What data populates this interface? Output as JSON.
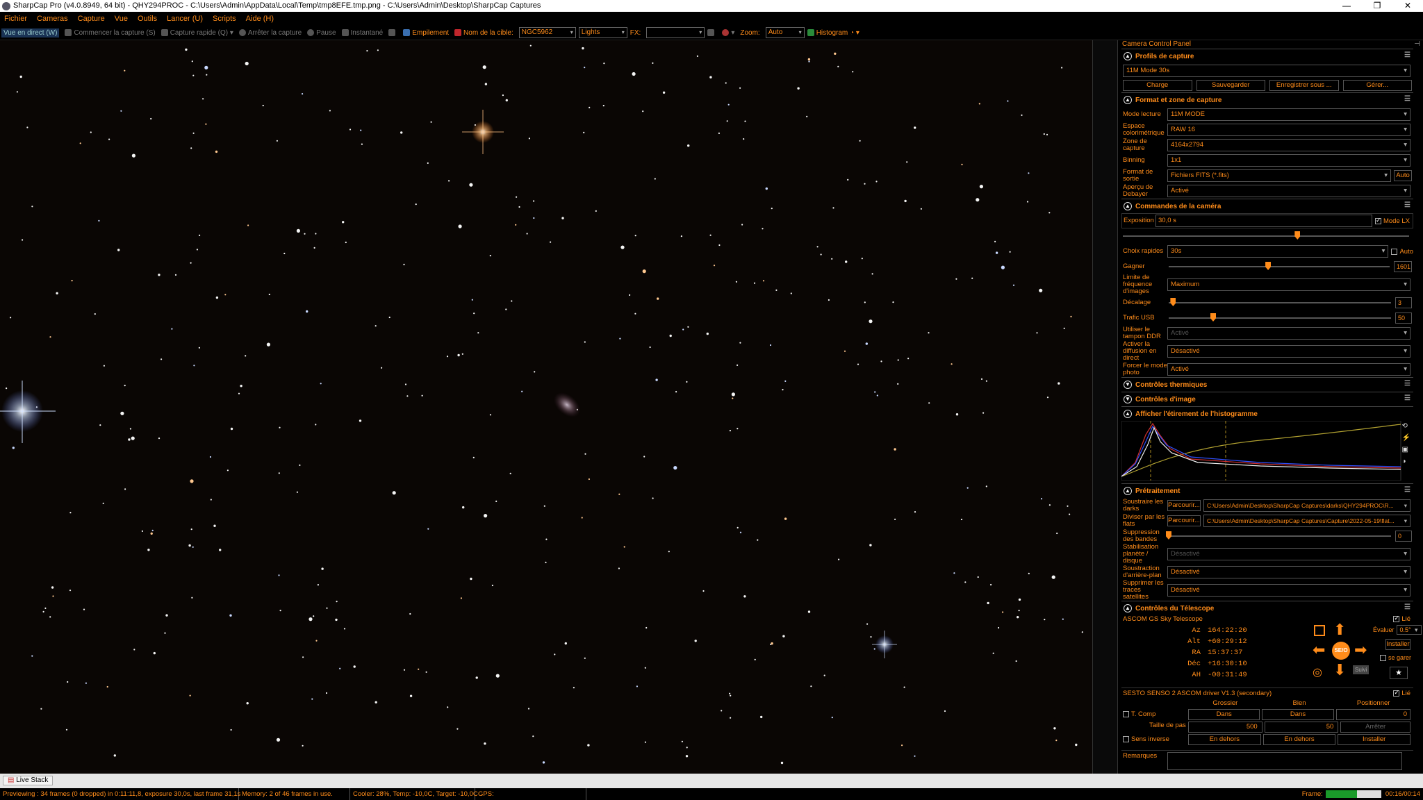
{
  "window": {
    "title": "SharpCap Pro (v4.0.8949, 64 bit) - QHY294PROC - C:\\Users\\Admin\\AppData\\Local\\Temp\\tmp8EFE.tmp.png - C:\\Users\\Admin\\Desktop\\SharpCap Captures"
  },
  "menu": [
    "Fichier",
    "Cameras",
    "Capture",
    "Vue",
    "Outils",
    "Lancer (U)",
    "Scripts",
    "Aide (H)"
  ],
  "toolbar": {
    "live_view": "Vue en direct (W)",
    "start_capture": "Commencer la capture (S)",
    "quick_capture": "Capture rapide (Q)",
    "stop_capture": "Arrêter la capture",
    "pause": "Pause",
    "snapshot": "Instantané",
    "stacking": "Empilement",
    "target_label": "Nom de la cible:",
    "target_value": "NGC5962",
    "frame_type": "Lights",
    "fx_label": "FX:",
    "zoom_label": "Zoom:",
    "zoom_value": "Auto",
    "histogram": "Histogram"
  },
  "panel": {
    "title": "Camera Control Panel",
    "profiles": {
      "header": "Profils de capture",
      "selected": "11M Mode 30s",
      "buttons": [
        "Charge",
        "Sauvegarder",
        "Enregistrer sous ...",
        "Gérer..."
      ]
    },
    "format": {
      "header": "Format et zone de capture",
      "rows": [
        {
          "label": "Mode lecture",
          "value": "11M MODE"
        },
        {
          "label": "Espace colorimétrique",
          "value": "RAW 16"
        },
        {
          "label": "Zone de capture",
          "value": "4164x2794"
        },
        {
          "label": "Binning",
          "value": "1x1"
        },
        {
          "label": "Format de sortie",
          "value": "Fichiers FITS (*.fits)",
          "extra": "Auto"
        },
        {
          "label": "Aperçu de Debayer",
          "value": "Activé"
        }
      ]
    },
    "camera": {
      "header": "Commandes de la caméra",
      "exposure_label": "Exposition",
      "exposure_value": "30,0 s",
      "lx_label": "Mode LX",
      "exposure_level": 0.61,
      "quick_label": "Choix rapides",
      "quick_value": "30s",
      "quick_auto": "Auto",
      "gain_label": "Gagner",
      "gain_value": "1601",
      "gain_level": 0.45,
      "framerate_label": "Limite de fréquence d'images",
      "framerate_value": "Maximum",
      "offset_label": "Décalage",
      "offset_value": "3",
      "offset_level": 0.02,
      "usb_label": "Trafic USB",
      "usb_value": "50",
      "usb_level": 0.2,
      "ddr_label": "Utiliser le tampon DDR",
      "ddr_value": "Activé",
      "broadcast_label": "Activer la diffusion en direct",
      "broadcast_value": "Désactivé",
      "photo_label": "Forcer le mode photo",
      "photo_value": "Activé"
    },
    "thermal_header": "Contrôles thermiques",
    "image_header": "Contrôles d'image",
    "histogram_header": "Afficher l'étirement de l'histogramme",
    "preprocess": {
      "header": "Prétraitement",
      "dark_label": "Soustraire les darks",
      "dark_browse": "Parcourir...",
      "dark_path": "C:\\Users\\Admin\\Desktop\\SharpCap Captures\\darks\\QHY294PROC\\R...",
      "flat_label": "Diviser par les flats",
      "flat_browse": "Parcourir...",
      "flat_path": "C:\\Users\\Admin\\Desktop\\SharpCap Captures\\Capture\\2022-05-19\\flat...",
      "banding_label": "Suppression des bandes",
      "banding_value": "0",
      "banding_level": 0,
      "stab_label": "Stabilisation planète / disque",
      "stab_value": "Désactivé",
      "bg_label": "Soustraction d'arrière-plan",
      "bg_value": "Désactivé",
      "sat_label": "Supprimer les traces satellites",
      "sat_value": "Désactivé"
    },
    "telescope": {
      "header": "Contrôles du Télescope",
      "mount": "ASCOM GS Sky Telescope",
      "linked": "Lié",
      "coords": [
        {
          "k": "Az",
          "v": "164:22:20"
        },
        {
          "k": "Alt",
          "v": "+60:29:12"
        },
        {
          "k": "RA",
          "v": "15:37:37"
        },
        {
          "k": "Déc",
          "v": "+16:30:10"
        },
        {
          "k": "AH",
          "v": "-00:31:49"
        }
      ],
      "rate_label": "Évaluer",
      "rate_value": "0.5°",
      "install": "Installer",
      "park": "se garer",
      "follow": "Suivi",
      "center": "SE/O"
    },
    "focuser": {
      "name": "SESTO SENSO 2 ASCOM driver V1.3 (secondary)",
      "linked": "Lié",
      "col_coarse": "Grossier",
      "col_fine": "Bien",
      "col_pos": "Positionner",
      "tcomp": "T. Comp",
      "in": "Dans",
      "pos_value": "0",
      "step_label": "Taille de pas",
      "step_coarse": "500",
      "step_fine": "50",
      "stop": "Arrêter",
      "reverse": "Sens inverse",
      "out": "En dehors",
      "install": "Installer"
    },
    "notes_label": "Remarques"
  },
  "status": {
    "live_stack": "Live Stack",
    "preview": "Previewing : 34 frames (0 dropped) in 0:11:11,8, exposure 30,0s, last frame 31,1s",
    "memory": "Memory: 2 of 46 frames in use.",
    "cooler": "Cooler: 28%, Temp: -10,0C, Target: -10,0C",
    "gps": "GPS:",
    "frame_label": "Frame:",
    "frame_progress": 0.56,
    "frame_time": "00:16/00:14"
  },
  "colors": {
    "accent": "#ff8c1a",
    "background": "#000000"
  }
}
